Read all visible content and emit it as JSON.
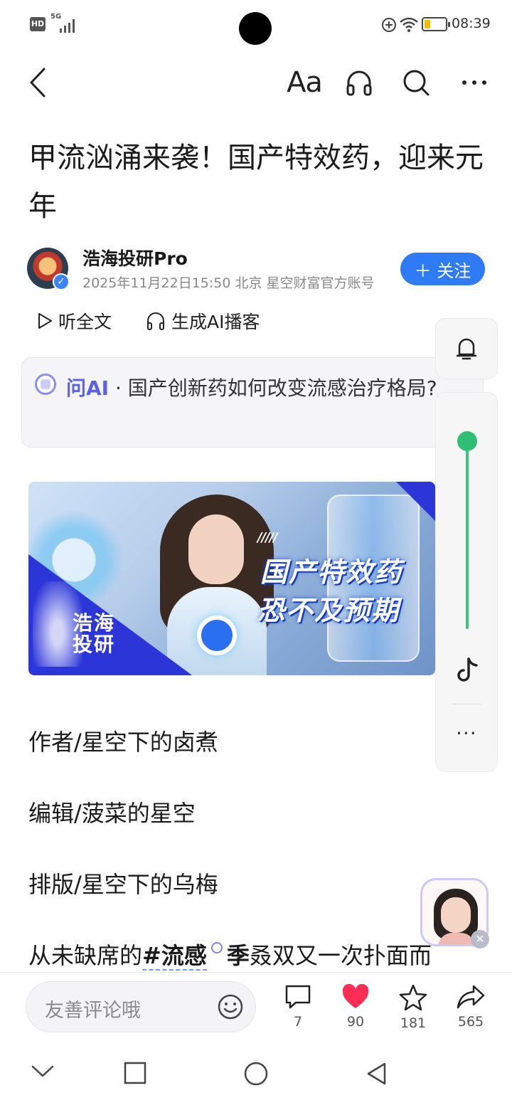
{
  "status": {
    "hd": "HD",
    "network": "5G",
    "time": "08:39"
  },
  "nav": {
    "font_label": "Aa"
  },
  "article": {
    "title": "甲流汹涌来袭！国产特效药，迎来元年",
    "author": {
      "name": "浩海投研Pro",
      "meta": "2025年11月22日15:50 北京 星空财富官方账号",
      "follow_label": "＋ 关注"
    },
    "listen_label": "听全文",
    "podcast_label": "生成AI播客",
    "ask_ai": {
      "tag": "问AI",
      "question": " · 国产创新药如何改变流感治疗格局?"
    },
    "banner": {
      "stripes": "/////",
      "line1": "国产特效药",
      "line2": "恐不及预期",
      "brand": "浩海投研"
    },
    "credits": {
      "author": "作者/星空下的卤煮",
      "editor": "编辑/菠菜的星空",
      "layout": "排版/星空下的乌梅"
    },
    "body": {
      "prefix": "从未缺席的",
      "hashtag": "#流感",
      "suffix_bold": "季",
      "suffix": "叒双又一次扑面而"
    }
  },
  "side_panel": {
    "more": "···",
    "audio_progress": 0.0
  },
  "actions": {
    "comment_placeholder": "友善评论哦",
    "comments": "7",
    "likes": "90",
    "favorites": "181",
    "shares": "565"
  },
  "colors": {
    "accent": "#2f7bf5",
    "like": "#ff2d55",
    "progress": "#2fbf73",
    "ai": "#5c62e6"
  }
}
